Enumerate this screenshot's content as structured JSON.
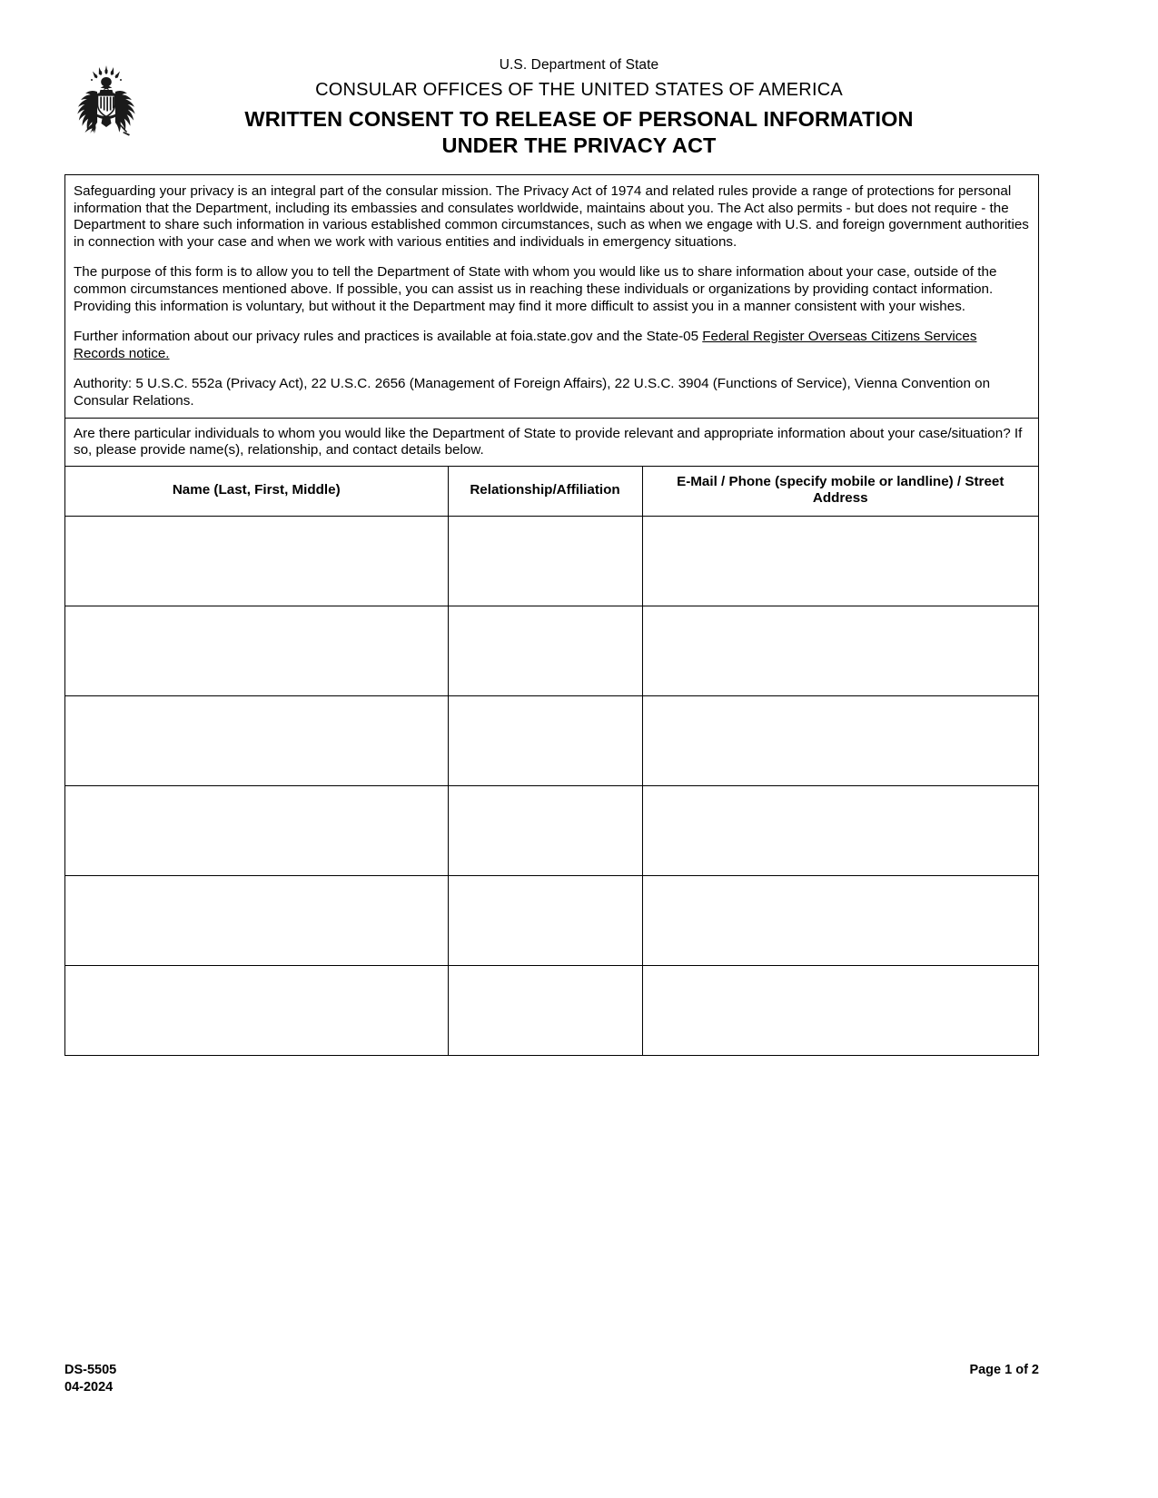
{
  "header": {
    "seal_icon": "great-seal-eagle-icon",
    "department": "U.S. Department of State",
    "office": "CONSULAR OFFICES OF THE UNITED STATES OF AMERICA",
    "title_line1": "WRITTEN CONSENT TO RELEASE OF PERSONAL INFORMATION",
    "title_line2": "UNDER THE PRIVACY ACT"
  },
  "notice": {
    "paragraph1": "Safeguarding your privacy is an integral part of the consular mission. The Privacy Act of 1974 and related rules provide a range of protections for personal information that the Department, including its embassies and consulates worldwide, maintains about you. The Act also permits - but does not require - the Department to share such information in various established common circumstances, such as when we engage with U.S. and foreign government authorities in connection with your case and when we work with various entities and individuals in emergency situations.",
    "paragraph2": "The purpose of this form is to allow you to tell the Department of State with whom you would like us to share information about your case, outside of the common circumstances mentioned above.  If possible, you can assist us in reaching these individuals or organizations by providing contact information. Providing this information is voluntary, but without it the Department may find it more difficult to assist you in a manner consistent with your wishes.",
    "paragraph3_prefix": "Further information about our privacy rules and practices is available at foia.state.gov and the State-05 ",
    "paragraph3_link": "Federal Register Overseas Citizens Services Records notice.",
    "paragraph4": "Authority: 5 U.S.C. 552a (Privacy Act), 22 U.S.C. 2656 (Management of Foreign Affairs), 22 U.S.C. 3904 (Functions of Service), Vienna Convention on Consular Relations."
  },
  "question": {
    "prompt": "Are there particular individuals to whom you would like the Department of State to provide relevant and appropriate information about your case/situation? If so, please provide name(s), relationship, and contact details below."
  },
  "table": {
    "columns": [
      "Name (Last, First, Middle)",
      "Relationship/Affiliation",
      "E-Mail / Phone (specify mobile or landline) / Street Address"
    ],
    "rows": [
      [
        "",
        "",
        ""
      ],
      [
        "",
        "",
        ""
      ],
      [
        "",
        "",
        ""
      ],
      [
        "",
        "",
        ""
      ],
      [
        "",
        "",
        ""
      ],
      [
        "",
        "",
        ""
      ]
    ]
  },
  "footer": {
    "form_number": "DS-5505",
    "form_date": "04-2024",
    "page_label": "Page 1 of 2"
  }
}
